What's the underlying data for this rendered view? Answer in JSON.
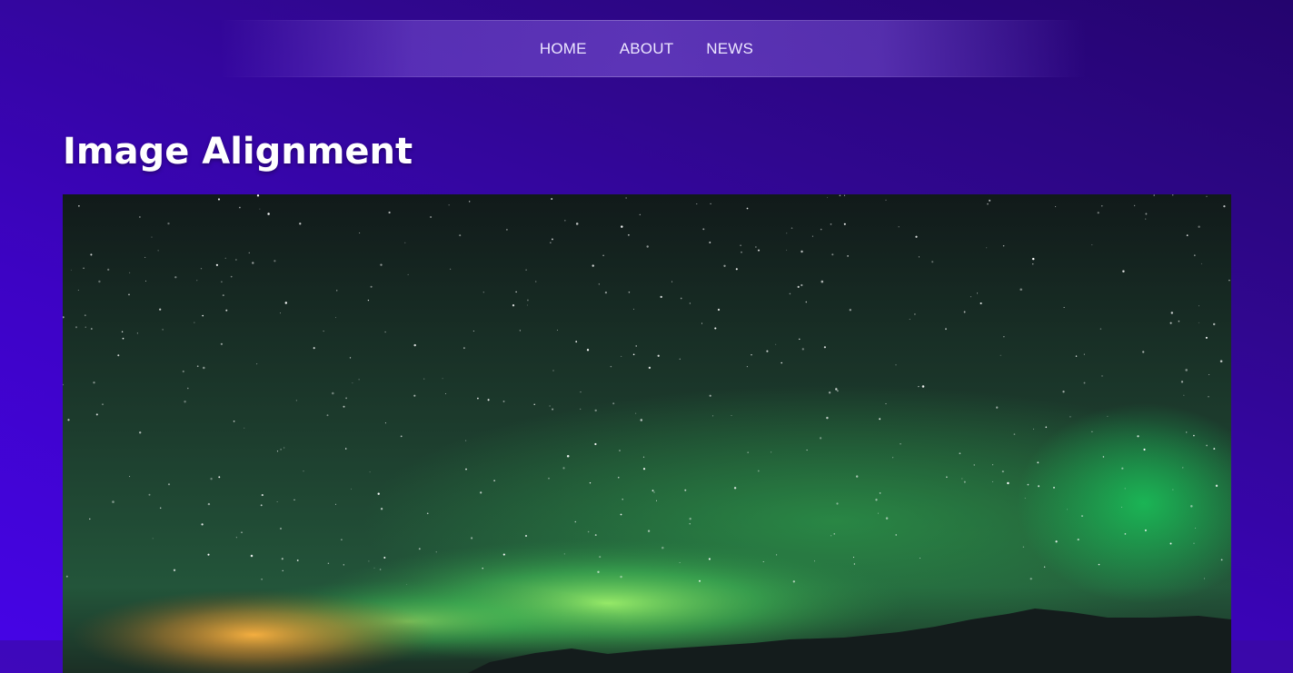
{
  "nav": {
    "items": [
      {
        "label": "HOME"
      },
      {
        "label": "ABOUT"
      },
      {
        "label": "NEWS"
      }
    ]
  },
  "page": {
    "title": "Image Alignment"
  },
  "image": {
    "subject": "aurora-night-sky-photo"
  }
}
